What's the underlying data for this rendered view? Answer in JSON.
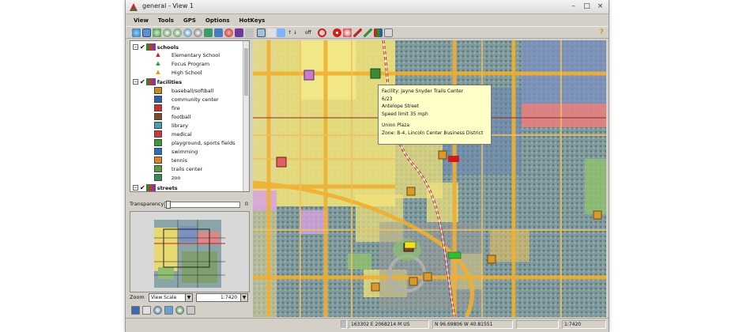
{
  "window": {
    "title": "general - View 1",
    "controls": [
      "–",
      "□",
      "×"
    ]
  },
  "menu": [
    "View",
    "Tools",
    "GPS",
    "Options",
    "HotKeys"
  ],
  "toolbar": {
    "help_glyph": "?",
    "text_tools": [
      "↑ ↓",
      "off"
    ]
  },
  "layers": {
    "schools": {
      "label": "schools",
      "items": [
        {
          "label": "Elementary School",
          "glyph": "▲",
          "color": "#d21a1a"
        },
        {
          "label": "Focus Program",
          "glyph": "▲",
          "color": "#2e9a2e"
        },
        {
          "label": "High School",
          "glyph": "▲",
          "color": "#d4a000"
        }
      ]
    },
    "facilities": {
      "label": "facilities",
      "items": [
        {
          "label": "baseball/softball",
          "color": "#c98a2a"
        },
        {
          "label": "community center",
          "color": "#2d5fb0"
        },
        {
          "label": "fire",
          "color": "#c93030"
        },
        {
          "label": "football",
          "color": "#7a4a2a"
        },
        {
          "label": "library",
          "color": "#4aa0a8"
        },
        {
          "label": "medical",
          "color": "#c83a3a"
        },
        {
          "label": "playground, sports fields",
          "color": "#3a9a3a"
        },
        {
          "label": "swimming",
          "color": "#2a70c0"
        },
        {
          "label": "tennis",
          "color": "#d08a20"
        },
        {
          "label": "trails center",
          "color": "#5a9a3a"
        },
        {
          "label": "zoo",
          "color": "#3a8a5a"
        }
      ]
    },
    "streets": {
      "label": "streets"
    }
  },
  "transparency": {
    "label": "Transparency",
    "value": "0",
    "fraction": 0
  },
  "zoom": {
    "label": "Zoom",
    "selected": "View Scale",
    "scale": "1:7420"
  },
  "tooltip": {
    "lines": [
      "Facility: Jayne Snyder Trails Center",
      "6/23",
      "Antelope Street",
      "Speed limit 35 mph",
      "",
      "Union Plaza",
      "Zone: B-4, Lincoln Center Business District"
    ]
  },
  "status": {
    "coord1": "163302 E  2068214 M US",
    "coord2": "N 96.69806 W 40.81551",
    "scale": "1:7420"
  },
  "colors": {
    "yellow_zone": "#f1e37a",
    "road": "#f0b030",
    "pink_zone": "#e68080",
    "blue_zone": "#7c90c2",
    "green_zone": "#8fbf70",
    "railroad": "#c81e1e",
    "tooltip_bg": "#ffffc8"
  }
}
